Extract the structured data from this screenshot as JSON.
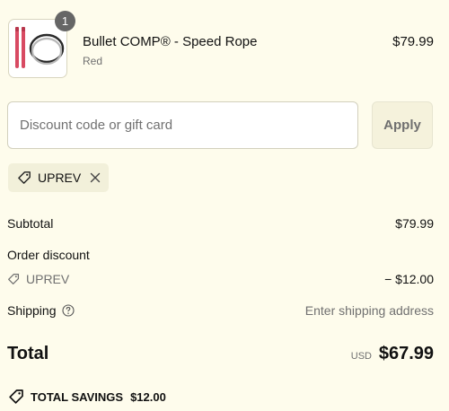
{
  "line_item": {
    "quantity": "1",
    "name": "Bullet COMP® - Speed Rope",
    "variant": "Red",
    "price": "$79.99",
    "image_colors": {
      "handle": "#d84a62",
      "rope_dark": "#2a2a2a",
      "rope_light": "#b7b7b7"
    }
  },
  "discount": {
    "placeholder": "Discount code or gift card",
    "value": "",
    "apply_label": "Apply",
    "applied_code": "UPREV"
  },
  "summary": {
    "subtotal_label": "Subtotal",
    "subtotal_value": "$79.99",
    "order_discount_label": "Order discount",
    "discount_code": "UPREV",
    "discount_value": "− $12.00",
    "shipping_label": "Shipping",
    "shipping_value": "Enter shipping address",
    "total_label": "Total",
    "currency": "USD",
    "total_value": "$67.99",
    "savings_label": "TOTAL SAVINGS",
    "savings_value": "$12.00"
  },
  "icons": {
    "tag": "tag-icon",
    "remove": "close-icon",
    "help": "help-circle-icon"
  },
  "colors": {
    "background": "#fefcec",
    "input_border": "#d2d0bd",
    "apply_bg": "#f5f2dc",
    "tag_bg": "#f2f0da",
    "muted_text": "#707070"
  }
}
